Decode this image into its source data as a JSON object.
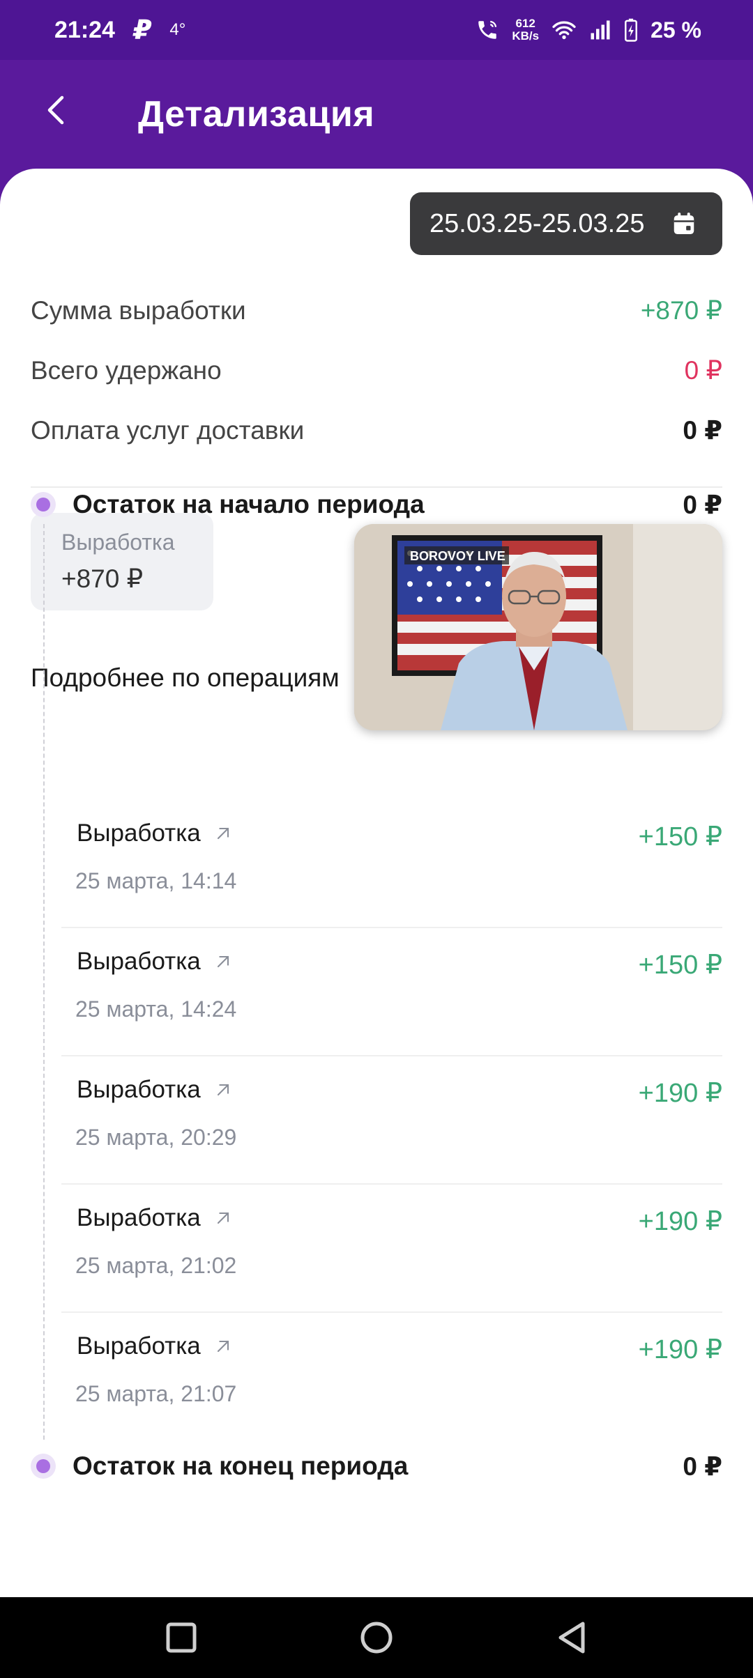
{
  "status_bar": {
    "time": "21:24",
    "ruble_glyph": "₽",
    "temperature": "4°",
    "net_speed_value": "612",
    "net_speed_unit": "KB/s",
    "battery_percent": "25 %"
  },
  "header": {
    "title": "Детализация",
    "back_icon": "chevron-left-icon"
  },
  "date_range": {
    "value": "25.03.25-25.03.25",
    "icon": "calendar-icon"
  },
  "summary": [
    {
      "label": "Сумма выработки",
      "value": "+870 ₽",
      "tone": "green"
    },
    {
      "label": "Всего удержано",
      "value": "0 ₽",
      "tone": "red"
    },
    {
      "label": "Оплата услуг доставки",
      "value": "0 ₽",
      "tone": "black"
    }
  ],
  "filter_chip": {
    "label": "Выработка",
    "value": "+870 ₽"
  },
  "video_overlay": {
    "caption": "BOROVOY LIVE"
  },
  "operations_heading": "Подробнее по операциям",
  "start_balance": {
    "label": "Остаток на начало периода",
    "value": "0 ₽"
  },
  "operations": [
    {
      "title": "Выработка",
      "time": "25 марта, 14:14",
      "amount": "+150 ₽"
    },
    {
      "title": "Выработка",
      "time": "25 марта, 14:24",
      "amount": "+150 ₽"
    },
    {
      "title": "Выработка",
      "time": "25 марта, 20:29",
      "amount": "+190 ₽"
    },
    {
      "title": "Выработка",
      "time": "25 марта, 21:02",
      "amount": "+190 ₽"
    },
    {
      "title": "Выработка",
      "time": "25 марта, 21:07",
      "amount": "+190 ₽"
    }
  ],
  "end_balance": {
    "label": "Остаток на конец периода",
    "value": "0 ₽"
  },
  "colors": {
    "header_purple": "#5a1a9c",
    "positive_green": "#3aa876",
    "negative_red": "#e0335f",
    "timeline_dot": "#a96fe2"
  }
}
